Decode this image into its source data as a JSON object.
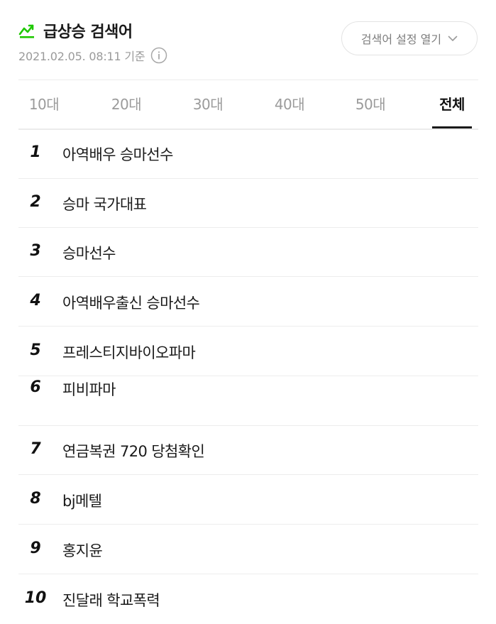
{
  "header": {
    "title": "급상승 검색어",
    "timestamp": "2021.02.05. 08:11 기준",
    "settings_button": "검색어 설정 열기",
    "icons": [
      "trend-chart-icon",
      "info-icon",
      "chevron-down-icon"
    ],
    "accent_color": "#1ec800"
  },
  "tabs": [
    {
      "label": "10대",
      "active": false
    },
    {
      "label": "20대",
      "active": false
    },
    {
      "label": "30대",
      "active": false
    },
    {
      "label": "40대",
      "active": false
    },
    {
      "label": "50대",
      "active": false
    },
    {
      "label": "전체",
      "active": true
    }
  ],
  "keywords": [
    {
      "rank": "1",
      "text": "아역배우 승마선수"
    },
    {
      "rank": "2",
      "text": "승마 국가대표"
    },
    {
      "rank": "3",
      "text": "승마선수"
    },
    {
      "rank": "4",
      "text": "아역배우출신 승마선수"
    },
    {
      "rank": "5",
      "text": "프레스티지바이오파마"
    },
    {
      "rank": "6",
      "text": "피비파마"
    },
    {
      "rank": "7",
      "text": "연금복권 720 당첨확인"
    },
    {
      "rank": "8",
      "text": "bj메텔"
    },
    {
      "rank": "9",
      "text": "홍지윤"
    },
    {
      "rank": "10",
      "text": "진달래 학교폭력"
    }
  ]
}
